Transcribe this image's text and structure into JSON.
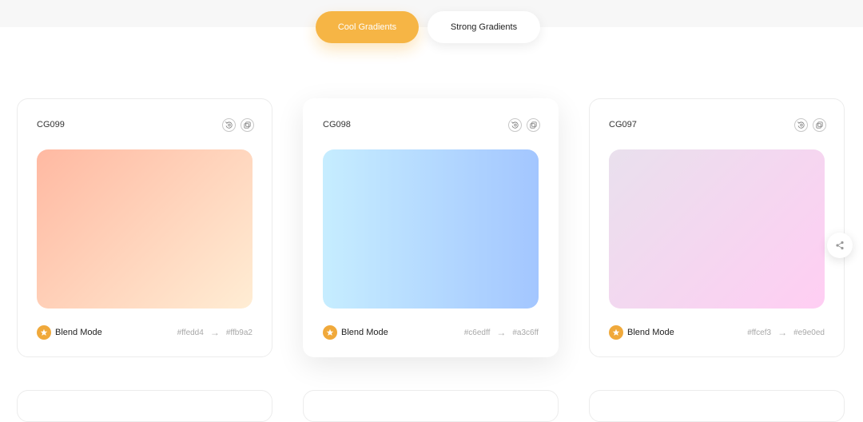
{
  "tabs": [
    {
      "label": "Cool Gradients",
      "active": true
    },
    {
      "label": "Strong Gradients",
      "active": false
    }
  ],
  "colors": {
    "accent": "#f6b23c",
    "star": "#f0a93b"
  },
  "cards": [
    {
      "code": "CG099",
      "from": "#ffedd4",
      "to": "#ffb9a2",
      "direction": "diagonal",
      "blend_label": "Blend Mode",
      "arrow": "→",
      "icons": [
        "rotate-icon",
        "copy-icon"
      ]
    },
    {
      "code": "CG098",
      "from": "#c6edff",
      "to": "#a3c6ff",
      "direction": "horizontal",
      "blend_label": "Blend Mode",
      "arrow": "→",
      "icons": [
        "rotate-icon",
        "copy-icon"
      ]
    },
    {
      "code": "CG097",
      "from": "#ffcef3",
      "to": "#e9e0ed",
      "direction": "diagonal",
      "blend_label": "Blend Mode",
      "arrow": "→",
      "icons": [
        "rotate-icon",
        "copy-icon"
      ]
    }
  ],
  "share": {
    "icon": "share-icon"
  }
}
